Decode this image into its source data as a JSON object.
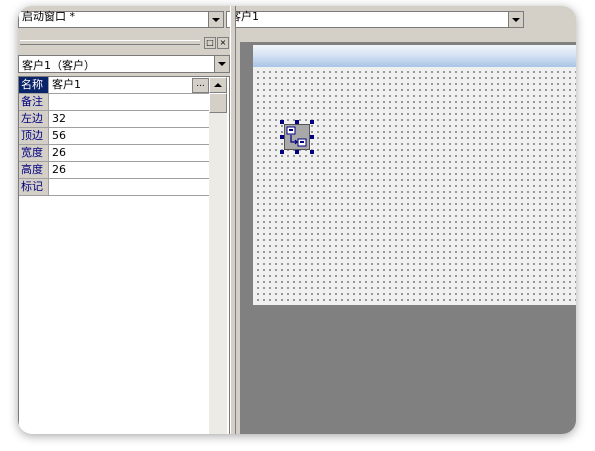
{
  "toolbar": {
    "window_combo_value": "启动窗口 *",
    "object_combo_value": "客户1"
  },
  "panel": {
    "pin_button": "□",
    "close_button": "×"
  },
  "object_selector": {
    "value": "客户1（客户）"
  },
  "properties": {
    "rows": [
      {
        "name": "名称",
        "value": "客户1",
        "selected": true
      },
      {
        "name": "备注",
        "value": ""
      },
      {
        "name": "左边",
        "value": "32"
      },
      {
        "name": "顶边",
        "value": "56"
      },
      {
        "name": "宽度",
        "value": "26"
      },
      {
        "name": "高度",
        "value": "26"
      },
      {
        "name": "标记",
        "value": ""
      }
    ],
    "ellipsis_button": "..."
  },
  "colors": {
    "selected_row": "#0a246a",
    "property_name_text": "#000080",
    "workspace_bg": "#808080",
    "title_bar_gradient_end": "#a9c4e6"
  },
  "icons": {
    "component": "client-component-icon"
  }
}
